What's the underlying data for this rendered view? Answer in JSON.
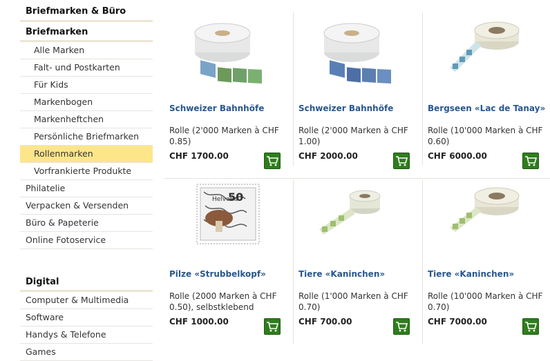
{
  "sidebar": {
    "sections": [
      {
        "title": "Briefmarken & Büro",
        "subtitle": "Briefmarken",
        "subitems": [
          "Alle Marken",
          "Falt- und Postkarten",
          "Für Kids",
          "Markenbogen",
          "Markenheftchen",
          "Persönliche Briefmarken",
          "Rollenmarken",
          "Vorfrankierte Produkte"
        ],
        "active_subitem": "Rollenmarken",
        "items": [
          "Philatelie",
          "Verpacken & Versenden",
          "Büro & Papeterie",
          "Online Fotoservice"
        ]
      },
      {
        "title": "Digital",
        "items": [
          "Computer & Multimedia",
          "Software",
          "Handys & Telefone",
          "Games"
        ]
      }
    ]
  },
  "products": [
    {
      "name": "Schweizer Bahnhöfe",
      "description": "Rolle (2'000 Marken à CHF 0.85)",
      "price": "CHF 1700.00",
      "image": "stamp-roll-image"
    },
    {
      "name": "Schweizer Bahnhöfe",
      "description": "Rolle (2'000 Marken à CHF 1.00)",
      "price": "CHF 2000.00",
      "image": "stamp-roll-image"
    },
    {
      "name": "Bergseen «Lac de Tanay»",
      "description": "Rolle (10'000 Marken à CHF 0.60)",
      "price": "CHF 6000.00",
      "image": "stamp-roll-image"
    },
    {
      "name": "Pilze «Strubbelkopf»",
      "description": "Rolle (2000 Marken à CHF 0.50), selbstklebend",
      "price": "CHF 1000.00",
      "image": "mushroom-stamp-image",
      "stamp_text": "Helvetia 50"
    },
    {
      "name": "Tiere «Kaninchen»",
      "description": "Rolle (1'000 Marken à CHF 0.70)",
      "price": "CHF 700.00",
      "image": "stamp-roll-image"
    },
    {
      "name": "Tiere «Kaninchen»",
      "description": "Rolle (10'000 Marken à CHF 0.70)",
      "price": "CHF 7000.00",
      "image": "stamp-roll-image"
    }
  ],
  "icons": {
    "cart": "shopping-cart-icon"
  },
  "colors": {
    "accent_link": "#28578f",
    "active_bg": "#fde68a",
    "cart_button": "#2f7d1d"
  }
}
